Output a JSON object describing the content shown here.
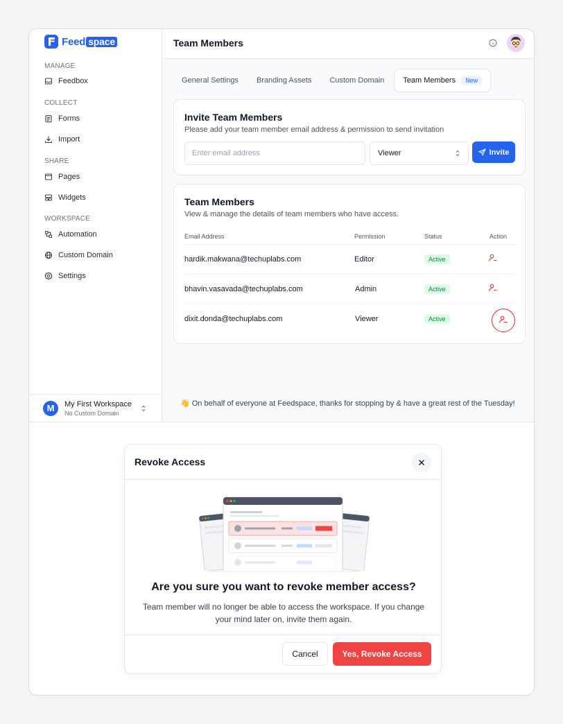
{
  "brand": {
    "name_part1": "Feed",
    "name_part2": "space"
  },
  "sidebar": {
    "sections": [
      {
        "label": "MANAGE",
        "items": [
          {
            "label": "Feedbox",
            "icon": "inbox-icon"
          }
        ]
      },
      {
        "label": "COLLECT",
        "items": [
          {
            "label": "Forms",
            "icon": "clipboard-icon"
          },
          {
            "label": "Import",
            "icon": "download-icon"
          }
        ]
      },
      {
        "label": "SHARE",
        "items": [
          {
            "label": "Pages",
            "icon": "window-icon"
          },
          {
            "label": "Widgets",
            "icon": "widget-icon"
          }
        ]
      },
      {
        "label": "WORKSPACE",
        "items": [
          {
            "label": "Automation",
            "icon": "automation-icon"
          },
          {
            "label": "Custom Domain",
            "icon": "globe-icon"
          },
          {
            "label": "Settings",
            "icon": "gear-icon"
          }
        ]
      }
    ],
    "workspace": {
      "initial": "M",
      "name": "My First Workspace",
      "sub": "No Custom Domain"
    }
  },
  "header": {
    "title": "Team Members"
  },
  "tabs": [
    {
      "label": "General Settings"
    },
    {
      "label": "Branding Assets"
    },
    {
      "label": "Custom Domain"
    },
    {
      "label": "Team Members",
      "badge": "New",
      "active": true
    }
  ],
  "invite": {
    "title": "Invite Team Members",
    "subtitle": "Please add your team member email address & permission to send invitation",
    "email_placeholder": "Enter email address",
    "permission": "Viewer",
    "button": "Invite"
  },
  "members": {
    "title": "Team Members",
    "subtitle": "View & manage the details of team members who have access.",
    "columns": [
      "Email Address",
      "Permission",
      "Status",
      "Action"
    ],
    "rows": [
      {
        "email": "hardik.makwana@techuplabs.com",
        "permission": "Editor",
        "status": "Active"
      },
      {
        "email": "bhavin.vasavada@techuplabs.com",
        "permission": "Admin",
        "status": "Active"
      },
      {
        "email": "dixit.donda@techuplabs.com",
        "permission": "Viewer",
        "status": "Active"
      }
    ]
  },
  "footer_message": "👋 On behalf of everyone at Feedspace, thanks for stopping by & have a great rest of the Tuesday!",
  "modal": {
    "title": "Revoke Access",
    "question": "Are you sure you want to revoke member access?",
    "description": "Team member will no longer be able to access the workspace. If you change your mind later on, invite them again.",
    "cancel": "Cancel",
    "confirm": "Yes, Revoke Access"
  },
  "colors": {
    "primary": "#2563eb",
    "danger": "#ef4444",
    "success_bg": "#dcfce7",
    "success_text": "#15803d"
  }
}
